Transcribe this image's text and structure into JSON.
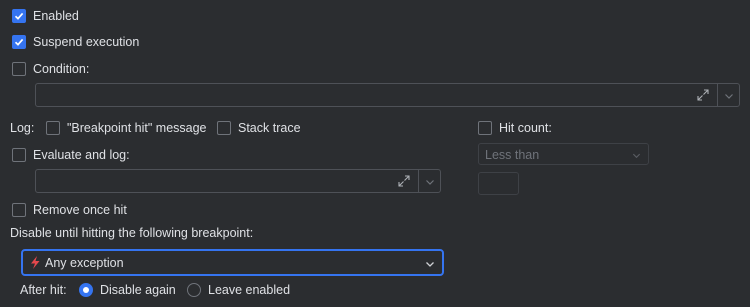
{
  "colors": {
    "accent": "#3574f0",
    "background": "#2b2d30",
    "error_icon": "#e5484d"
  },
  "enabled": {
    "label": "Enabled",
    "checked": true
  },
  "suspend": {
    "label": "Suspend execution",
    "checked": true
  },
  "condition": {
    "label": "Condition:",
    "checked": false,
    "value": ""
  },
  "log": {
    "label": "Log:",
    "breakpoint_hit": {
      "label": "\"Breakpoint hit\" message",
      "checked": false
    },
    "stack_trace": {
      "label": "Stack trace",
      "checked": false
    }
  },
  "evaluate": {
    "label": "Evaluate and log:",
    "checked": false,
    "value": ""
  },
  "hit_count": {
    "label": "Hit count:",
    "checked": false,
    "operator": "Less than",
    "value": ""
  },
  "remove_once_hit": {
    "label": "Remove once hit",
    "checked": false
  },
  "disable_until": {
    "label": "Disable until hitting the following breakpoint:",
    "selected": "Any exception",
    "icon": "lightning-icon"
  },
  "after_hit": {
    "label": "After hit:",
    "options": [
      {
        "label": "Disable again",
        "selected": true
      },
      {
        "label": "Leave enabled",
        "selected": false
      }
    ]
  }
}
